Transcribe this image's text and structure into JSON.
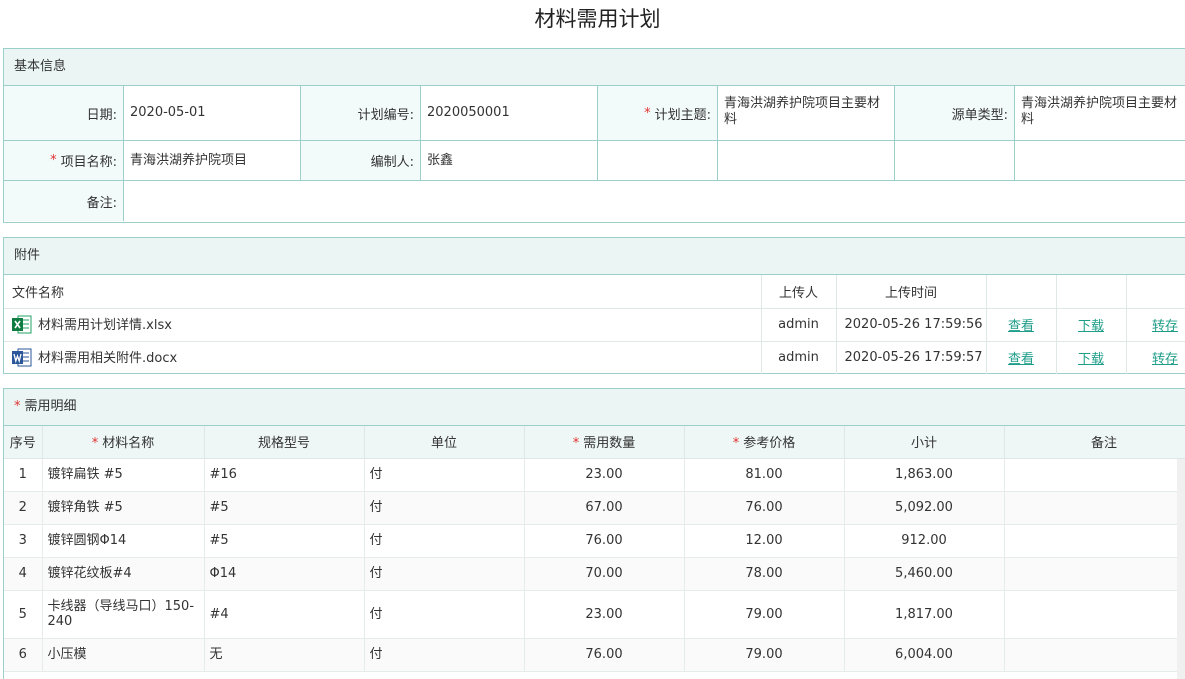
{
  "title": "材料需用计划",
  "basic": {
    "header": "基本信息",
    "date_label": "日期:",
    "date_value": "2020-05-01",
    "plan_no_label": "计划编号:",
    "plan_no_value": "2020050001",
    "subject_label": "计划主题:",
    "subject_value": "青海洪湖养护院项目主要材料",
    "source_type_label": "源单类型:",
    "source_type_value": "青海洪湖养护院项目主要材料",
    "project_label": "项目名称:",
    "project_value": "青海洪湖养护院项目",
    "author_label": "编制人:",
    "author_value": "张鑫",
    "remark_label": "备注:",
    "remark_value": "",
    "required_mark": "*"
  },
  "attachments": {
    "header": "附件",
    "col_name": "文件名称",
    "col_uploader": "上传人",
    "col_time": "上传时间",
    "actions": {
      "view": "查看",
      "download": "下载",
      "save": "转存"
    },
    "files": [
      {
        "name": "材料需用计划详情.xlsx",
        "icon": "excel-icon",
        "uploader": "admin",
        "time": "2020-05-26 17:59:56"
      },
      {
        "name": "材料需用相关附件.docx",
        "icon": "word-icon",
        "uploader": "admin",
        "time": "2020-05-26 17:59:57"
      }
    ]
  },
  "detail": {
    "header": "需用明细",
    "columns": {
      "seq": "序号",
      "material": "材料名称",
      "spec": "规格型号",
      "unit": "单位",
      "qty": "需用数量",
      "price": "参考价格",
      "subtotal": "小计",
      "remark": "备注"
    },
    "rows": [
      {
        "seq": "1",
        "material": "镀锌扁铁 #5",
        "spec": "#16",
        "unit": "付",
        "qty": "23.00",
        "price": "81.00",
        "subtotal": "1,863.00",
        "remark": ""
      },
      {
        "seq": "2",
        "material": "镀锌角铁 #5",
        "spec": "#5",
        "unit": "付",
        "qty": "67.00",
        "price": "76.00",
        "subtotal": "5,092.00",
        "remark": ""
      },
      {
        "seq": "3",
        "material": "镀锌圆钢Φ14",
        "spec": "#5",
        "unit": "付",
        "qty": "76.00",
        "price": "12.00",
        "subtotal": "912.00",
        "remark": ""
      },
      {
        "seq": "4",
        "material": "镀锌花纹板#4",
        "spec": "Φ14",
        "unit": "付",
        "qty": "70.00",
        "price": "78.00",
        "subtotal": "5,460.00",
        "remark": ""
      },
      {
        "seq": "5",
        "material": "卡线器（导线马口）150-240",
        "spec": "#4",
        "unit": "付",
        "qty": "23.00",
        "price": "79.00",
        "subtotal": "1,817.00",
        "remark": ""
      },
      {
        "seq": "6",
        "material": "小压模",
        "spec": "无",
        "unit": "付",
        "qty": "76.00",
        "price": "79.00",
        "subtotal": "6,004.00",
        "remark": ""
      }
    ]
  },
  "colors": {
    "border": "#9ccfc9",
    "header_bg": "#eaf5f4",
    "link": "#1f9d88",
    "required": "#e0312f"
  }
}
